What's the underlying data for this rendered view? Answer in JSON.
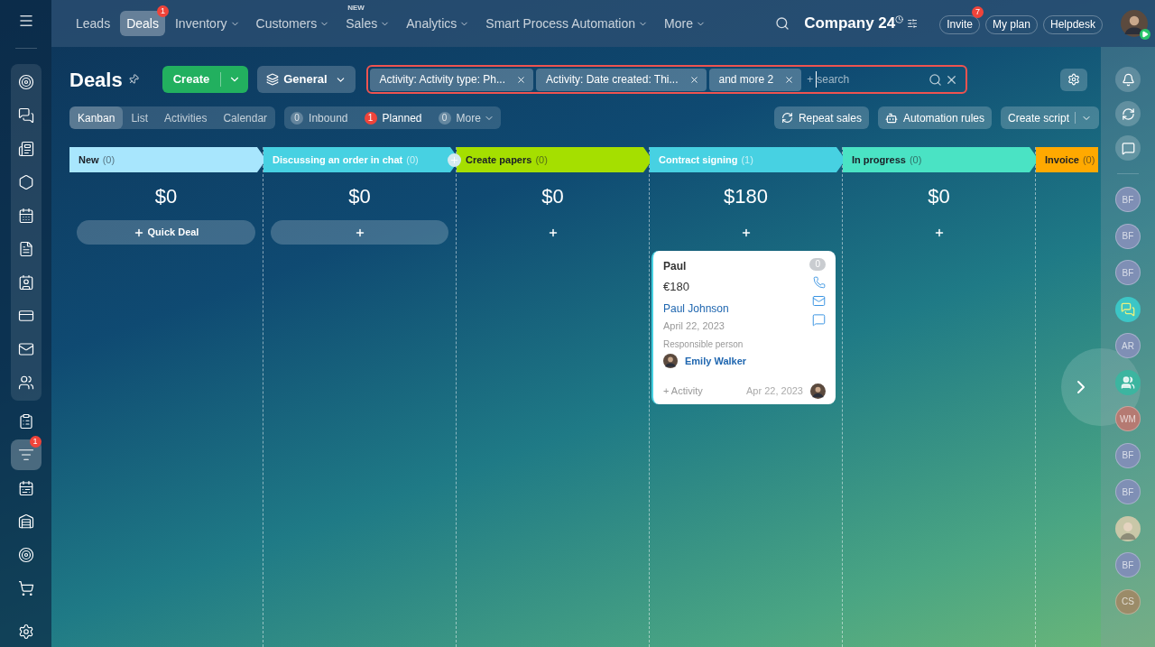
{
  "top_nav": {
    "items": [
      {
        "label": "Leads",
        "selected": false,
        "dropdown": false
      },
      {
        "label": "Deals",
        "selected": true,
        "dropdown": false,
        "badge": "1"
      },
      {
        "label": "Inventory",
        "selected": false,
        "dropdown": true
      },
      {
        "label": "Customers",
        "selected": false,
        "dropdown": true
      },
      {
        "label": "Sales",
        "selected": false,
        "dropdown": true,
        "tag": "NEW"
      },
      {
        "label": "Analytics",
        "selected": false,
        "dropdown": true
      },
      {
        "label": "Smart Process Automation",
        "selected": false,
        "dropdown": true
      },
      {
        "label": "More",
        "selected": false,
        "dropdown": true
      }
    ],
    "company": "Company 24",
    "buttons": [
      {
        "label": "Invite",
        "badge": "7"
      },
      {
        "label": "My plan"
      },
      {
        "label": "Helpdesk"
      }
    ]
  },
  "left_sidebar": {
    "items": [
      {
        "selected": false
      },
      {
        "selected": false
      },
      {
        "selected": false
      },
      {
        "selected": false
      },
      {
        "selected": false
      },
      {
        "selected": false
      },
      {
        "selected": false
      },
      {
        "selected": false
      },
      {
        "selected": false
      },
      {
        "selected": false
      },
      {
        "selected": false
      },
      {
        "selected": true,
        "badge": "1"
      },
      {
        "selected": false
      },
      {
        "selected": false
      },
      {
        "selected": false
      },
      {
        "selected": false
      },
      {
        "selected": false
      }
    ]
  },
  "page": {
    "title": "Deals",
    "create": "Create",
    "category": "General",
    "filters": [
      "Activity: Activity type: Ph...",
      "Activity: Date created: Thi...",
      "and more 2"
    ],
    "search_placeholder": "search",
    "add_sign": "+"
  },
  "view_tabs": [
    {
      "label": "Kanban",
      "selected": true
    },
    {
      "label": "List",
      "selected": false
    },
    {
      "label": "Activities",
      "selected": false
    },
    {
      "label": "Calendar",
      "selected": false
    }
  ],
  "counters": [
    {
      "count": "0",
      "label": "Inbound",
      "alert": false
    },
    {
      "count": "1",
      "label": "Planned",
      "alert": true
    },
    {
      "count": "0",
      "label": "More",
      "alert": false,
      "dropdown": true
    }
  ],
  "actions": [
    {
      "label": "Repeat sales",
      "kind": "repeat"
    },
    {
      "label": "Automation rules",
      "kind": "robot"
    },
    {
      "label": "Create script",
      "kind": "split"
    }
  ],
  "columns": [
    {
      "title": "New",
      "count": "(0)",
      "color": "#a8e6fd",
      "dark_text": true,
      "total": "$0",
      "add_label": "Quick Deal",
      "add_button": true
    },
    {
      "title": "Discussing an order in chat",
      "count": "(0)",
      "color": "#47d1e2",
      "dark_text": false,
      "total": "$0",
      "add_button": true,
      "add_stage": true
    },
    {
      "title": "Create papers",
      "count": "(0)",
      "color": "#a5df00",
      "dark_text": true,
      "total": "$0",
      "add_button": false
    },
    {
      "title": "Contract signing",
      "count": "(1)",
      "color": "#47d1e2",
      "dark_text": false,
      "total": "$180",
      "add_button": false,
      "cards": [
        {
          "title": "Paul",
          "amount": "€180",
          "contact": "Paul Johnson",
          "date": "April 22, 2023",
          "responsible_label": "Responsible person",
          "responsible": "Emily Walker",
          "activity": "+ Activity",
          "activity_date": "Apr 22, 2023",
          "counter": "0"
        }
      ]
    },
    {
      "title": "In progress",
      "count": "(0)",
      "color": "#4ae3c4",
      "dark_text": true,
      "total": "$0",
      "add_button": false
    },
    {
      "title": "Invoice",
      "count": "(0)",
      "color": "#ffa900",
      "dark_text": true
    }
  ],
  "right_sidebar": {
    "contacts": [
      {
        "kind": "initials",
        "initials": "BF",
        "color": "#7f8fb5"
      },
      {
        "kind": "initials",
        "initials": "BF",
        "color": "#7f8fb5"
      },
      {
        "kind": "initials",
        "initials": "BF",
        "color": "#7f8fb5"
      },
      {
        "kind": "chat",
        "color": "#3cc6c6"
      },
      {
        "kind": "initials",
        "initials": "AR",
        "color": "#7f8fb5"
      },
      {
        "kind": "group",
        "color": "#3cb5a0"
      },
      {
        "kind": "initials",
        "initials": "WM",
        "color": "#b57a72"
      },
      {
        "kind": "initials",
        "initials": "BF",
        "color": "#7f8fb5"
      },
      {
        "kind": "initials",
        "initials": "BF",
        "color": "#7f8fb5"
      },
      {
        "kind": "photo",
        "color": "#c9c7a8"
      },
      {
        "kind": "initials",
        "initials": "BF",
        "color": "#7f8fb5"
      },
      {
        "kind": "initials",
        "initials": "CS",
        "color": "#9b8b68"
      }
    ]
  }
}
